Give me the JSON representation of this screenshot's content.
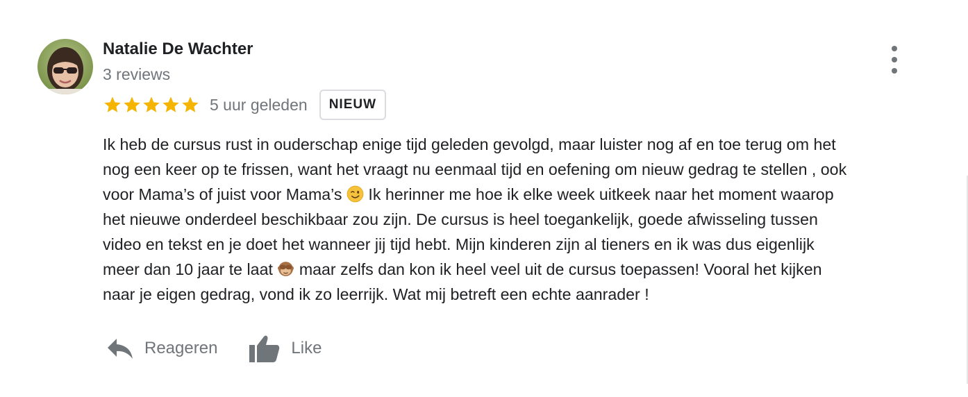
{
  "review": {
    "author": {
      "name": "Natalie De Wachter",
      "review_count": "3 reviews"
    },
    "rating": {
      "stars": 5,
      "max_stars": 5,
      "star_color": "#f4b400"
    },
    "time_ago": "5 uur geleden",
    "badge": "NIEUW",
    "text_lines": [
      "Ik heb de cursus rust in ouderschap enige tijd geleden gevolgd, maar luister nog af en toe terug om het",
      "nog een keer op te frissen, want het vraagt nu eenmaal tijd en oefening om nieuw gedrag te stellen , ook",
      "voor Mama’s of juist voor Mama’s",
      " Ik herinner me hoe ik elke week uitkeek naar het moment waarop",
      "het nieuwe onderdeel beschikbaar zou zijn. De cursus is heel toegankelijk, goede afwisseling tussen",
      "video en tekst en je doet het wanneer jij tijd hebt.  Mijn kinderen zijn al tieners en ik was dus eigenlijk",
      "meer dan 10 jaar te laat",
      " maar zelfs dan kon ik heel veel uit de cursus toepassen! Vooral het kijken",
      "naar je eigen gedrag, vond ik zo leerrijk. Wat mij betreft een echte aanrader !"
    ],
    "emojis": [
      "winking-face-emoji",
      "see-no-evil-monkey-emoji"
    ],
    "actions": {
      "reply_label": "Reageren",
      "like_label": "Like"
    }
  },
  "colors": {
    "text_primary": "#202124",
    "text_secondary": "#70757a",
    "badge_border": "#dadce0",
    "star": "#f4b400"
  }
}
